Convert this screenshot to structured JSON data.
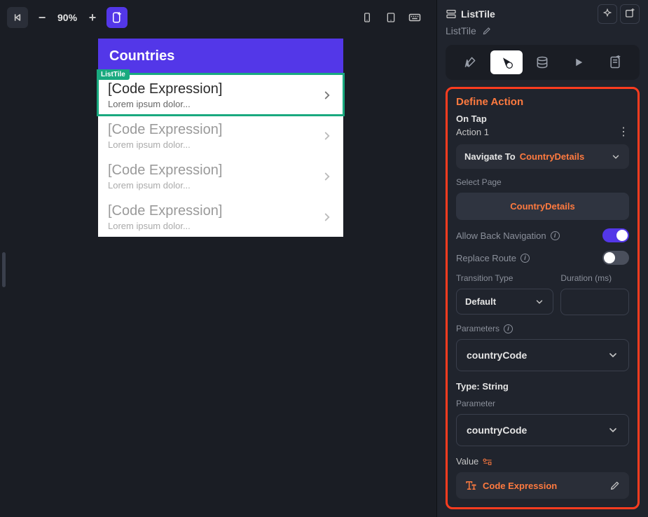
{
  "toolbar": {
    "zoom_value": "90%"
  },
  "canvas": {
    "app_title": "Countries",
    "list_tag": "ListTile",
    "items": [
      {
        "title": "[Code Expression]",
        "subtitle": "Lorem ipsum dolor...",
        "selected": true,
        "faded": false
      },
      {
        "title": "[Code Expression]",
        "subtitle": "Lorem ipsum dolor...",
        "selected": false,
        "faded": true
      },
      {
        "title": "[Code Expression]",
        "subtitle": "Lorem ipsum dolor...",
        "selected": false,
        "faded": true
      },
      {
        "title": "[Code Expression]",
        "subtitle": "Lorem ipsum dolor...",
        "selected": false,
        "faded": true
      }
    ]
  },
  "panel": {
    "header_title": "ListTile",
    "header_subtitle": "ListTile",
    "action_card": {
      "title": "Define Action",
      "trigger": "On Tap",
      "action_name": "Action 1",
      "navigate_label": "Navigate To",
      "navigate_value": "CountryDetails",
      "select_page_label": "Select Page",
      "selected_page": "CountryDetails",
      "allow_back_label": "Allow Back Navigation",
      "allow_back": true,
      "replace_route_label": "Replace Route",
      "replace_route": false,
      "transition_label": "Transition Type",
      "transition_value": "Default",
      "duration_label": "Duration (ms)",
      "parameters_label": "Parameters",
      "param_name": "countryCode",
      "type_text": "Type: String",
      "parameter_label": "Parameter",
      "parameter_value": "countryCode",
      "value_label": "Value",
      "value_text": "Code Expression"
    }
  }
}
